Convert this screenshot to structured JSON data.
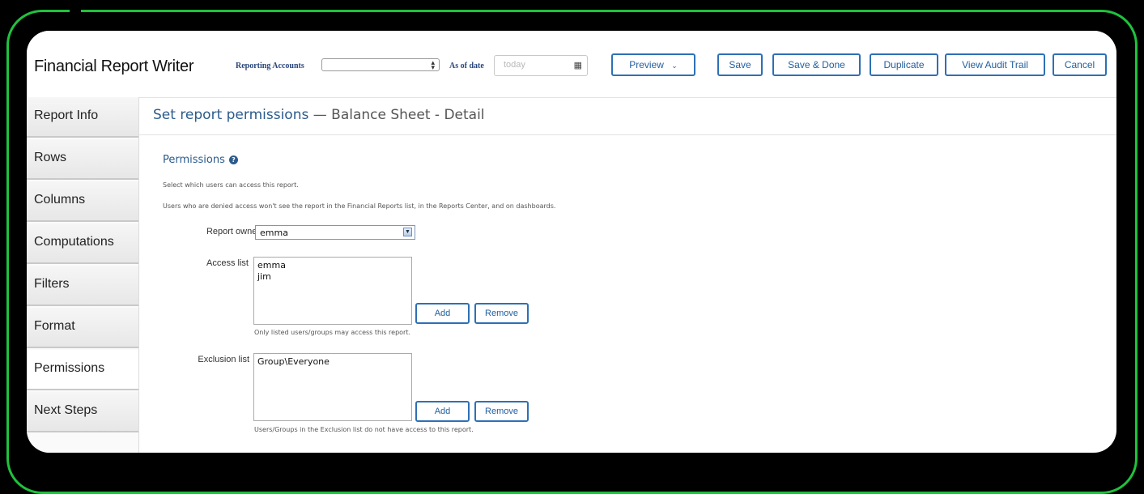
{
  "app": {
    "title": "Financial Report Writer"
  },
  "toolbar": {
    "reporting_accounts_label": "Reporting Accounts",
    "reporting_accounts_value": "",
    "as_of_date_label": "As of date",
    "as_of_date_placeholder": "today",
    "preview_label": "Preview",
    "save_label": "Save",
    "save_done_label": "Save & Done",
    "duplicate_label": "Duplicate",
    "audit_trail_label": "View Audit Trail",
    "cancel_label": "Cancel"
  },
  "sidebar": {
    "items": [
      {
        "label": "Report Info"
      },
      {
        "label": "Rows"
      },
      {
        "label": "Columns"
      },
      {
        "label": "Computations"
      },
      {
        "label": "Filters"
      },
      {
        "label": "Format"
      },
      {
        "label": "Permissions"
      },
      {
        "label": "Next Steps"
      }
    ],
    "active": "Permissions"
  },
  "page": {
    "title_main": "Set report permissions",
    "title_sub": " — Balance Sheet - Detail"
  },
  "permissions": {
    "section_title": "Permissions",
    "desc1": "Select which users can access this report.",
    "desc2": "Users who are denied access won't see the report in the Financial Reports list, in the Reports Center, and on dashboards.",
    "owner_label": "Report owner",
    "owner_value": "emma",
    "access_label": "Access list",
    "access_items": [
      "emma",
      "jim"
    ],
    "access_hint": "Only listed users/groups may access this report.",
    "exclusion_label": "Exclusion list",
    "exclusion_items": [
      "Group\\Everyone"
    ],
    "exclusion_hint": "Users/Groups in the Exclusion list do not have access to this report.",
    "add_label": "Add",
    "remove_label": "Remove"
  },
  "colors": {
    "frame": "#1fc23d",
    "accent": "#2d70b5",
    "heading": "#2b5b8c"
  }
}
